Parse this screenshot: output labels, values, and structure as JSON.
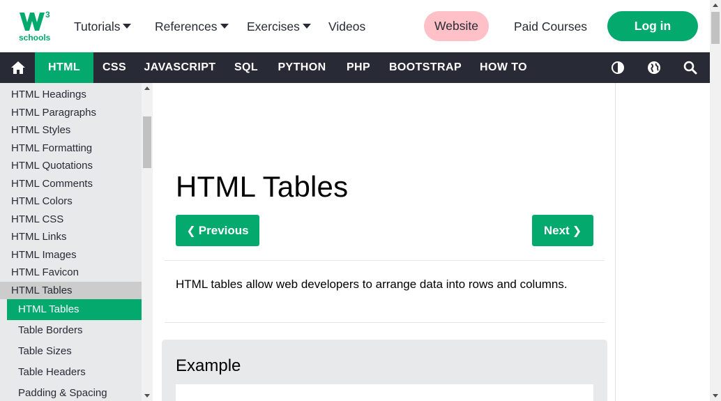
{
  "brand": {
    "logo_text": "schools",
    "logo_super": "3",
    "accent": "#04aa6d"
  },
  "topnav": {
    "tutorials": "Tutorials",
    "references": "References",
    "exercises": "Exercises",
    "videos": "Videos",
    "website": "Website",
    "paid_courses": "Paid Courses",
    "login": "Log in"
  },
  "subnav": {
    "items": [
      "HTML",
      "CSS",
      "JAVASCRIPT",
      "SQL",
      "PYTHON",
      "PHP",
      "BOOTSTRAP",
      "HOW TO"
    ],
    "active": "HTML",
    "icons": [
      "home-icon",
      "contrast-icon",
      "globe-icon",
      "search-icon"
    ]
  },
  "sidebar": {
    "items": [
      "HTML Headings",
      "HTML Paragraphs",
      "HTML Styles",
      "HTML Formatting",
      "HTML Quotations",
      "HTML Comments",
      "HTML Colors",
      "HTML CSS",
      "HTML Links",
      "HTML Images",
      "HTML Favicon",
      "HTML Tables"
    ],
    "subitems": [
      "HTML Tables",
      "Table Borders",
      "Table Sizes",
      "Table Headers",
      "Padding & Spacing"
    ],
    "active_subitem": "HTML Tables"
  },
  "main": {
    "title": "HTML Tables",
    "prev_label": "Previous",
    "next_label": "Next",
    "intro": "HTML tables allow web developers to arrange data into rows and columns.",
    "example_title": "Example"
  }
}
